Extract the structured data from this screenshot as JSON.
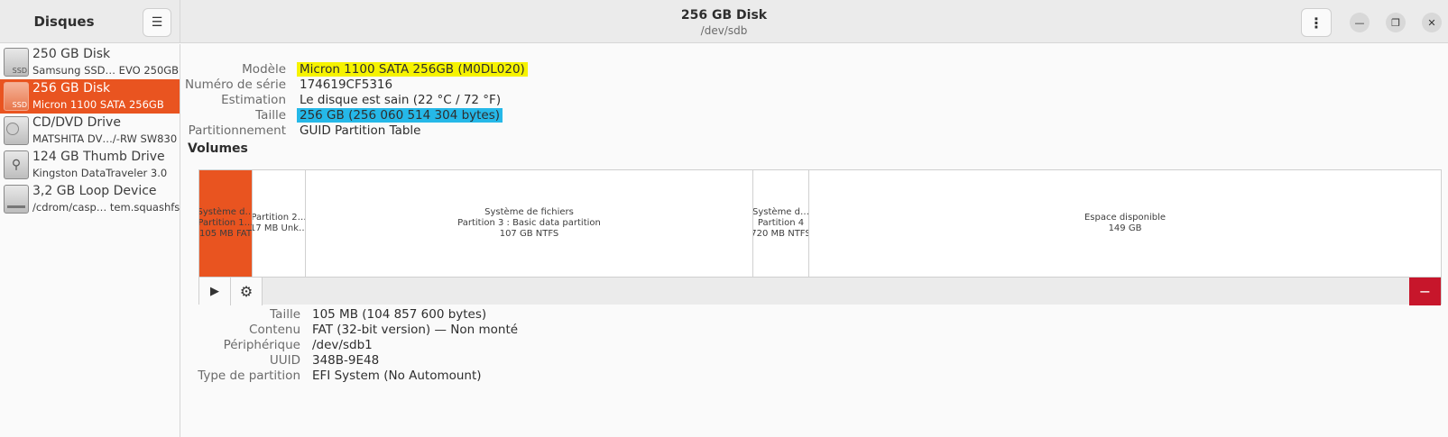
{
  "app": {
    "title": "Disques"
  },
  "header": {
    "disk_title": "256 GB Disk",
    "disk_subtitle": "/dev/sdb"
  },
  "sidebar": {
    "items": [
      {
        "name": "250 GB Disk",
        "model": "Samsung SSD… EVO 250GB",
        "icon": "ssd-icon",
        "icon_label": "SSD",
        "selected": false
      },
      {
        "name": "256 GB Disk",
        "model": "Micron 1100 SATA 256GB",
        "icon": "ssd-icon",
        "icon_label": "SSD",
        "selected": true
      },
      {
        "name": "CD/DVD Drive",
        "model": "MATSHITA DV…/-RW SW830",
        "icon": "optical-drive-icon",
        "icon_label": "",
        "selected": false
      },
      {
        "name": "124 GB Thumb Drive",
        "model": "Kingston DataTraveler 3.0",
        "icon": "usb-drive-icon",
        "icon_label": "",
        "selected": false
      },
      {
        "name": "3,2 GB Loop Device",
        "model": "/cdrom/casp… tem.squashfs",
        "icon": "loop-device-icon",
        "icon_label": "",
        "selected": false
      }
    ]
  },
  "disk_info": {
    "model_label": "Modèle",
    "model": "Micron 1100 SATA 256GB (M0DL020)",
    "serial_label": "Numéro de série",
    "serial": "174619CF5316",
    "assessment_label": "Estimation",
    "assessment": "Le disque est sain (22 °C / 72 °F)",
    "size_label": "Taille",
    "size": "256 GB (256 060 514 304 bytes)",
    "partitioning_label": "Partitionnement",
    "partitioning": "GUID Partition Table"
  },
  "volumes": {
    "title": "Volumes",
    "segments": [
      {
        "line1": "Système d…",
        "line2": "Partition 1…",
        "line3": "105 MB FAT",
        "selected": true
      },
      {
        "line1": "",
        "line2": "Partition 2…",
        "line3": "17 MB Unk…",
        "selected": false
      },
      {
        "line1": "Système de fichiers",
        "line2": "Partition 3 : Basic data partition",
        "line3": "107 GB NTFS",
        "selected": false
      },
      {
        "line1": "Système d…",
        "line2": "Partition 4",
        "line3": "720 MB NTFS",
        "selected": false
      },
      {
        "line1": "Espace disponible",
        "line2": "149 GB",
        "line3": "",
        "selected": false
      }
    ],
    "toolbar": {
      "mount_icon": "play-icon",
      "settings_icon": "gear-icon",
      "delete_icon": "minus-icon"
    }
  },
  "partition_details": {
    "size_label": "Taille",
    "size": "105 MB (104 857 600 bytes)",
    "content_label": "Contenu",
    "content": "FAT (32-bit version) — Non monté",
    "device_label": "Périphérique",
    "device": "/dev/sdb1",
    "uuid_label": "UUID",
    "uuid": "348B-9E48",
    "type_label": "Type de partition",
    "type": "EFI System (No Automount)"
  },
  "colors": {
    "accent": "#e95420",
    "highlight_yellow": "#f6f300",
    "highlight_blue": "#25b8e8",
    "danger": "#c7162b"
  }
}
